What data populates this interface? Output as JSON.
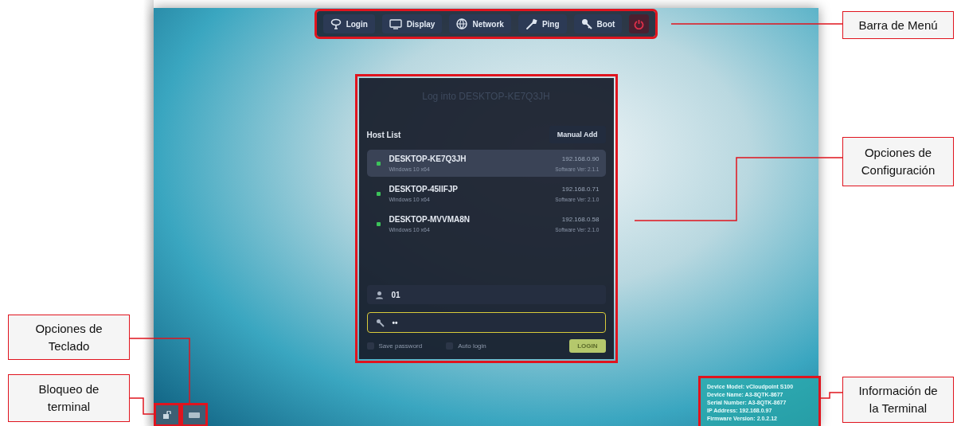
{
  "menu_bar": {
    "items": [
      {
        "label": "Login"
      },
      {
        "label": "Display"
      },
      {
        "label": "Network"
      },
      {
        "label": "Ping"
      },
      {
        "label": "Boot"
      }
    ]
  },
  "login_dialog": {
    "title": "Log into DESKTOP-KE7Q3JH",
    "host_list_label": "Host List",
    "manual_add_button": "Manual Add",
    "hosts": [
      {
        "name": "DESKTOP-KE7Q3JH",
        "os": "Windows 10 x64",
        "ip": "192.168.0.90",
        "version": "Software Ver: 2.1.1",
        "selected": true,
        "color": "#3cc35a"
      },
      {
        "name": "DESKTOP-45IIFJP",
        "os": "Windows 10 x64",
        "ip": "192.168.0.71",
        "version": "Software Ver: 2.1.0",
        "selected": false,
        "color": "#3cc35a"
      },
      {
        "name": "DESKTOP-MVVMA8N",
        "os": "Windows 10 x64",
        "ip": "192.168.0.58",
        "version": "Software Ver: 2.1.0",
        "selected": false,
        "color": "#3cc35a"
      }
    ],
    "username": "01",
    "password": "••",
    "options": [
      {
        "label": "Save password",
        "checked": false
      },
      {
        "label": "Auto login",
        "checked": false
      }
    ],
    "login_button": "LOGIN"
  },
  "terminal_info": [
    "Device Model: vCloudpoint S100",
    "Device Name: A3-8QTK-8677",
    "Serial Number: A3-8QTK-8677",
    "IP Address: 192.168.0.97",
    "Firmware Version: 2.0.2.12"
  ],
  "annotations": [
    {
      "label": "Barra de Menú"
    },
    {
      "label": "Opciones de Configuración"
    },
    {
      "label": "Opciones de Teclado"
    },
    {
      "label": "Bloqueo de terminal"
    },
    {
      "label": "Información de la Terminal"
    }
  ]
}
